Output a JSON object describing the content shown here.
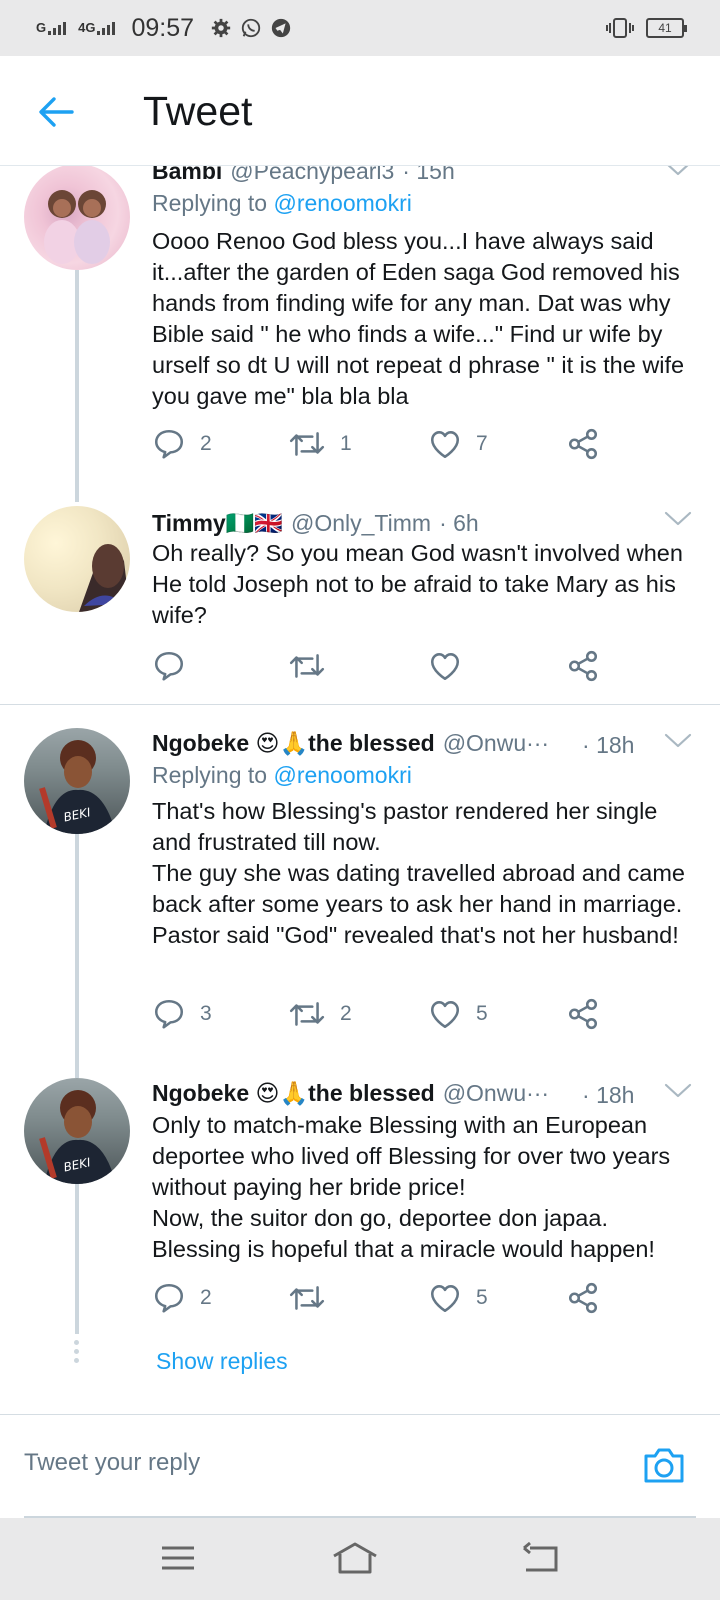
{
  "status_bar": {
    "signal_1": "G",
    "signal_2": "4G",
    "time": "09:57",
    "battery": "41"
  },
  "header": {
    "title": "Tweet"
  },
  "tweets": [
    {
      "name": "Bambi",
      "handle": "@Peachypearl3",
      "time": "15h",
      "replying_prefix": "Replying to ",
      "replying_to": "@renoomokri",
      "text": "Oooo Renoo God bless you...I have always said it...after the garden of Eden saga God removed his hands from finding wife for any man. Dat was why Bible said \" he who finds a wife...\" Find ur wife by urself so dt U will not repeat d phrase \" it is the wife you gave me\" bla bla bla",
      "replies": "2",
      "retweets": "1",
      "likes": "7"
    },
    {
      "name": "Timmy🇳🇬🇬🇧",
      "handle": "@Only_Timm",
      "time": "6h",
      "text": "Oh really? So you mean God wasn't involved when He told Joseph not to be afraid to take Mary as his wife?",
      "replies": "",
      "retweets": "",
      "likes": ""
    },
    {
      "name": "Ngobeke 😍🙏the blessed",
      "handle": "@Onwu···",
      "time": "18h",
      "replying_prefix": "Replying to ",
      "replying_to": "@renoomokri",
      "text": "That's how Blessing's pastor rendered her single and frustrated till now.\nThe guy she was dating travelled abroad and came back after some years to ask her hand in marriage. Pastor said \"God\" revealed that's not her husband!",
      "replies": "3",
      "retweets": "2",
      "likes": "5"
    },
    {
      "name": "Ngobeke 😍🙏the blessed",
      "handle": "@Onwu···",
      "time": "18h",
      "text": "Only to match-make Blessing with an European deportee who lived off Blessing for over two years without paying her bride price!\nNow, the suitor don go, deportee don japaa.\nBlessing is hopeful that a miracle would happen!",
      "replies": "2",
      "retweets": "",
      "likes": "5"
    }
  ],
  "show_replies": "Show replies",
  "reply_bar": {
    "placeholder": "Tweet your reply"
  },
  "colors": {
    "accent": "#1da1f2",
    "muted": "#657786",
    "text": "#14171a"
  },
  "icons": [
    "back-arrow-icon",
    "reply-icon",
    "retweet-icon",
    "like-icon",
    "share-icon",
    "camera-icon",
    "menu-icon",
    "home-icon",
    "back-icon",
    "caret-down-icon"
  ]
}
